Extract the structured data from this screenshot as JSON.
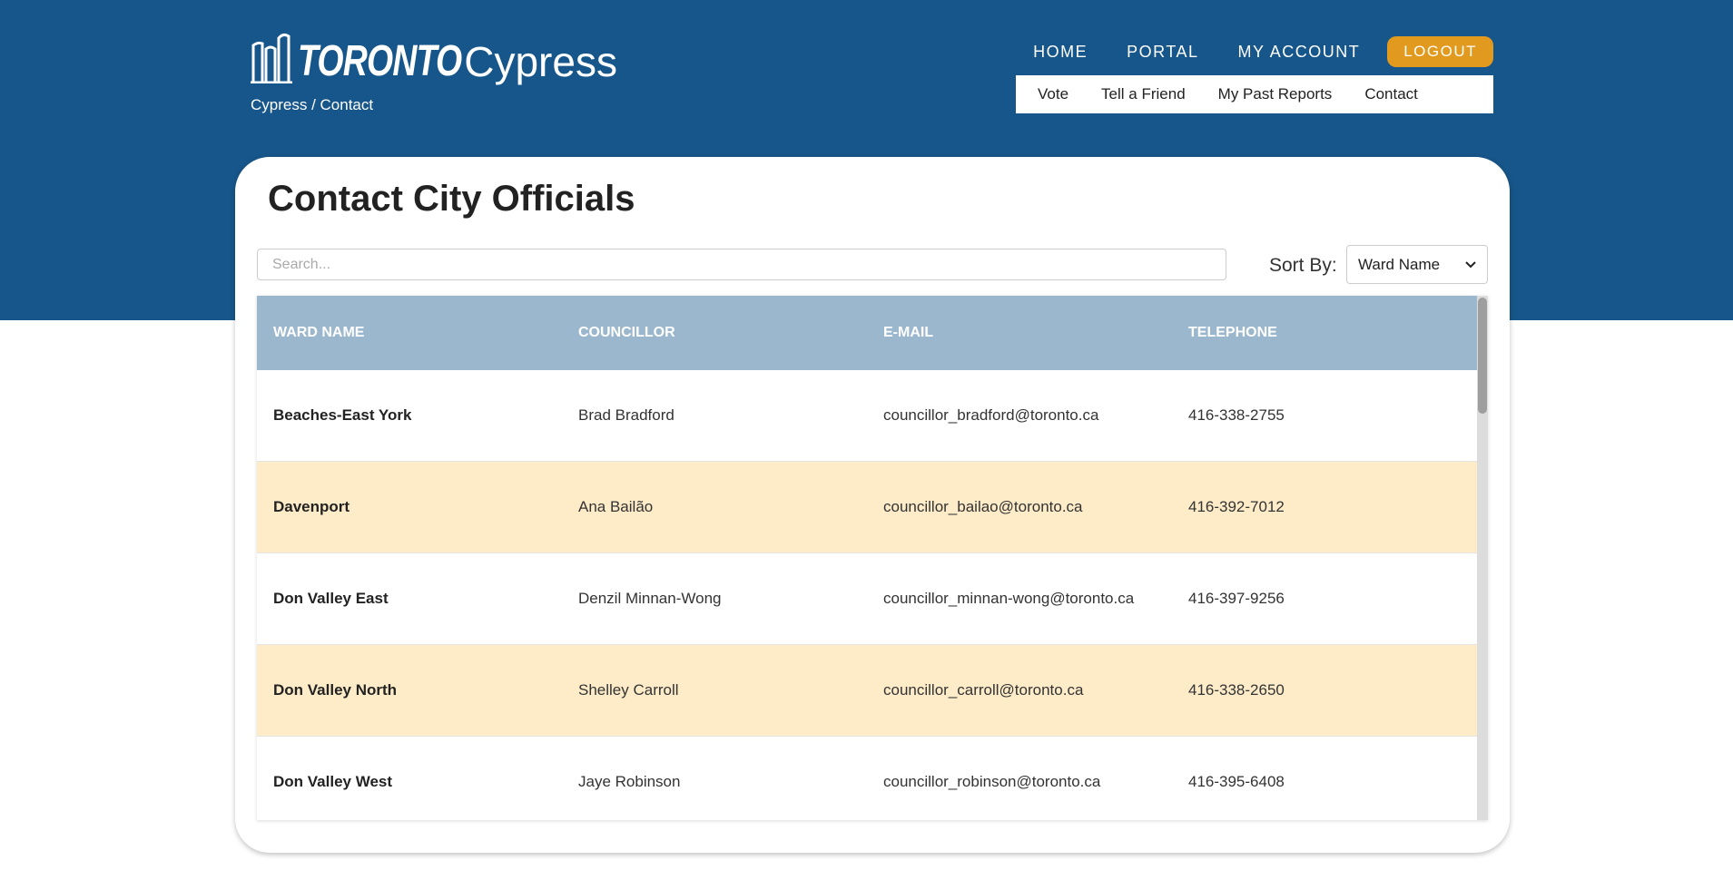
{
  "header": {
    "logo_word": "TORONTO",
    "logo_app": "Cypress",
    "breadcrumb": "Cypress / Contact",
    "nav": [
      "HOME",
      "PORTAL",
      "MY ACCOUNT"
    ],
    "logout_label": "LOGOUT",
    "subnav": [
      "Vote",
      "Tell a Friend",
      "My Past Reports",
      "Contact"
    ]
  },
  "page": {
    "title": "Contact City Officials",
    "search_placeholder": "Search...",
    "sort_label": "Sort By:",
    "sort_value": "Ward Name"
  },
  "table": {
    "columns": [
      "WARD NAME",
      "COUNCILLOR",
      "E-MAIL",
      "TELEPHONE"
    ],
    "rows": [
      {
        "ward": "Beaches-East York",
        "councillor": "Brad Bradford",
        "email": "councillor_bradford@toronto.ca",
        "phone": "416-338-2755"
      },
      {
        "ward": "Davenport",
        "councillor": "Ana Bailão",
        "email": "councillor_bailao@toronto.ca",
        "phone": "416-392-7012"
      },
      {
        "ward": "Don Valley East",
        "councillor": "Denzil Minnan-Wong",
        "email": "councillor_minnan-wong@toronto.ca",
        "phone": "416-397-9256"
      },
      {
        "ward": "Don Valley North",
        "councillor": "Shelley Carroll",
        "email": "councillor_carroll@toronto.ca",
        "phone": "416-338-2650"
      },
      {
        "ward": "Don Valley West",
        "councillor": "Jaye Robinson",
        "email": "councillor_robinson@toronto.ca",
        "phone": "416-395-6408"
      }
    ]
  },
  "colors": {
    "brand_blue": "#17568a",
    "header_row": "#9bb7cd",
    "alt_row": "#feecc8",
    "logout": "#e19a1d"
  }
}
